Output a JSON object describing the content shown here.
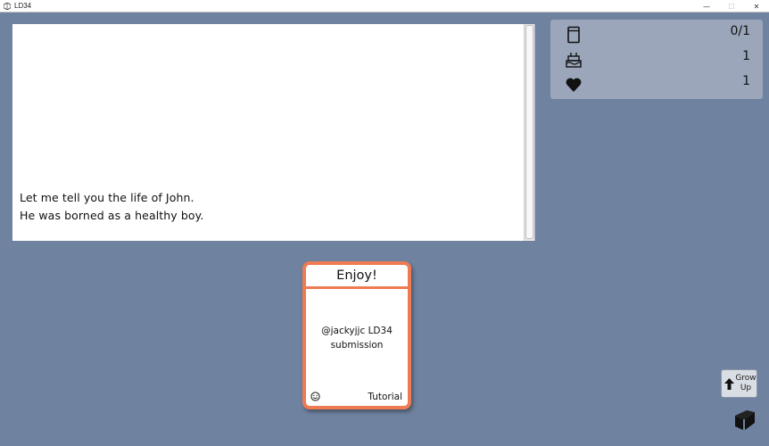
{
  "window": {
    "title": "LD34",
    "minimize": "—",
    "maximize": "☐",
    "close": "✕"
  },
  "story": {
    "lines": [
      "Let me tell you the life of John.",
      "He was borned as a healthy boy."
    ]
  },
  "stats": {
    "cards": {
      "icon": "card-icon",
      "value": "0/1"
    },
    "age": {
      "icon": "birthday-cake-icon",
      "value": "1"
    },
    "health": {
      "icon": "heart-icon",
      "value": "1"
    }
  },
  "card": {
    "title": "Enjoy!",
    "body_lines": [
      "@jackyjjc LD34",
      "submission"
    ],
    "footer_icon": "smiley-icon",
    "footer_label": "Tutorial",
    "border_color": "#ef7b52"
  },
  "grow_button": {
    "icon": "arrow-up-icon",
    "label_lines": [
      "Grow",
      "Up"
    ]
  },
  "logo": {
    "icon": "game-logo-icon"
  },
  "colors": {
    "background": "#6f82a0",
    "stats_panel": "#9ba6ba",
    "card_accent": "#ef7b52"
  }
}
